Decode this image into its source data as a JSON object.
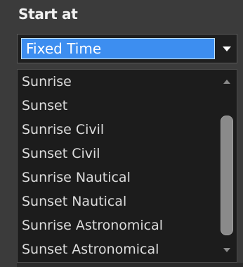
{
  "field": {
    "label": "Start at",
    "selected_value": "Fixed Time"
  },
  "dropdown": {
    "options": [
      "Sunrise",
      "Sunset",
      "Sunrise Civil",
      "Sunset Civil",
      "Sunrise Nautical",
      "Sunset Nautical",
      "Sunrise Astronomical",
      "Sunset Astronomical"
    ]
  },
  "icons": {
    "select_arrow": "chevron-down-icon",
    "scroll_up": "scroll-up-arrow-icon",
    "scroll_down": "scroll-down-arrow-icon"
  },
  "colors": {
    "selection_highlight": "#3d8ef0",
    "panel_background": "#3b3b3b",
    "list_background": "#1c1c1c"
  }
}
